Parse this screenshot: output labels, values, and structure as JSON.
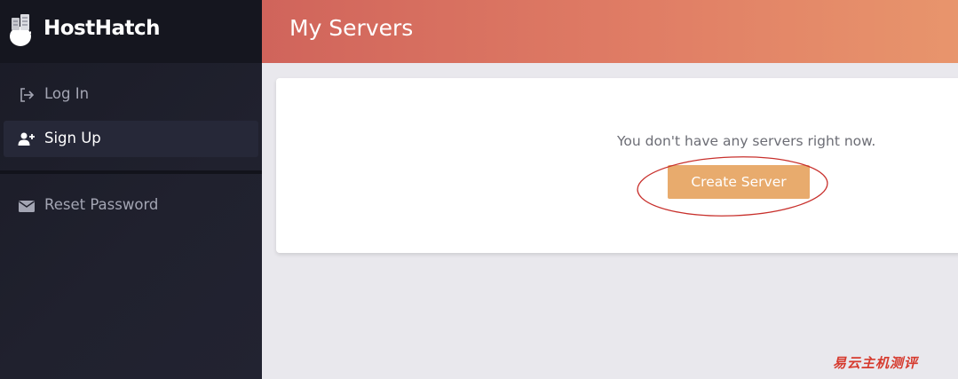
{
  "brand": {
    "name": "HostHatch",
    "logo_icon": "egg-server-logo"
  },
  "sidebar": {
    "items": [
      {
        "label": "Log In",
        "icon": "sign-in-icon",
        "active": false
      },
      {
        "label": "Sign Up",
        "icon": "user-plus-icon",
        "active": true
      },
      {
        "label": "Reset Password",
        "icon": "envelope-icon",
        "active": false
      }
    ]
  },
  "header": {
    "title": "My Servers"
  },
  "main": {
    "empty_message": "You don't have any servers right now.",
    "create_button_label": "Create Server"
  },
  "annotation": {
    "highlight": "red-ellipse-around-create-button"
  },
  "watermark": {
    "text": "易云主机测评"
  },
  "colors": {
    "sidebar_bg": "#1a1b26",
    "header_gradient_start": "#d0645b",
    "header_gradient_end": "#e8956c",
    "create_button": "#e8ab6d",
    "highlight_ellipse": "#c8302c",
    "watermark": "#d63a2e"
  }
}
